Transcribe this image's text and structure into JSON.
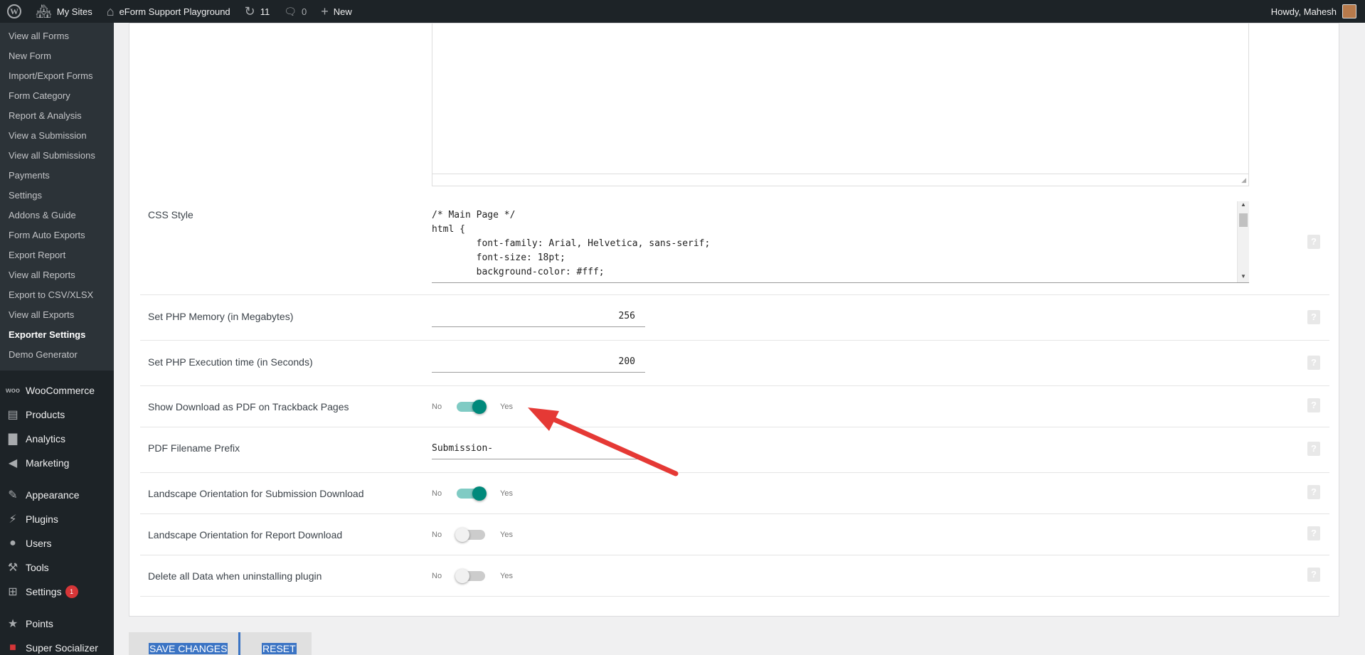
{
  "adminbar": {
    "my_sites": "My Sites",
    "site_name": "eForm Support Playground",
    "updates_count": "11",
    "comments_count": "0",
    "new_label": "New",
    "howdy": "Howdy, Mahesh"
  },
  "sidebar": {
    "submenu": [
      {
        "label": "View all Forms"
      },
      {
        "label": "New Form"
      },
      {
        "label": "Import/Export Forms"
      },
      {
        "label": "Form Category"
      },
      {
        "label": "Report & Analysis"
      },
      {
        "label": "View a Submission"
      },
      {
        "label": "View all Submissions"
      },
      {
        "label": "Payments"
      },
      {
        "label": "Settings"
      },
      {
        "label": "Addons & Guide"
      },
      {
        "label": "Form Auto Exports"
      },
      {
        "label": "Export Report"
      },
      {
        "label": "View all Reports"
      },
      {
        "label": "Export to CSV/XLSX"
      },
      {
        "label": "View all Exports"
      },
      {
        "label": "Exporter Settings"
      },
      {
        "label": "Demo Generator"
      }
    ],
    "menu": [
      {
        "label": "WooCommerce",
        "icon": "woo-icon"
      },
      {
        "label": "Products",
        "icon": "archive-icon"
      },
      {
        "label": "Analytics",
        "icon": "chart-bar-icon"
      },
      {
        "label": "Marketing",
        "icon": "megaphone-icon"
      },
      {
        "label": "Appearance",
        "icon": "paintbrush-icon"
      },
      {
        "label": "Plugins",
        "icon": "plug-icon"
      },
      {
        "label": "Users",
        "icon": "user-icon"
      },
      {
        "label": "Tools",
        "icon": "wrench-icon"
      },
      {
        "label": "Settings",
        "icon": "settings-icon",
        "badge": "1"
      },
      {
        "label": "Points",
        "icon": "star-icon"
      },
      {
        "label": "Super Socializer",
        "icon": "social-icon"
      }
    ]
  },
  "settings": {
    "css_style": {
      "label": "CSS Style",
      "code": "/* Main Page */\nhtml {\n        font-family: Arial, Helvetica, sans-serif;\n        font-size: 18pt;\n        background-color: #fff;"
    },
    "php_memory": {
      "label": "Set PHP Memory (in Megabytes)",
      "value": "256"
    },
    "php_exec": {
      "label": "Set PHP Execution time (in Seconds)",
      "value": "200"
    },
    "show_pdf": {
      "label": "Show Download as PDF on Trackback Pages",
      "no": "No",
      "yes": "Yes",
      "state": "on"
    },
    "pdf_prefix": {
      "label": "PDF Filename Prefix",
      "value": "Submission-"
    },
    "landscape_submission": {
      "label": "Landscape Orientation for Submission Download",
      "no": "No",
      "yes": "Yes",
      "state": "on"
    },
    "landscape_report": {
      "label": "Landscape Orientation for Report Download",
      "no": "No",
      "yes": "Yes",
      "state": "off"
    },
    "delete_data": {
      "label": "Delete all Data when uninstalling plugin",
      "no": "No",
      "yes": "Yes",
      "state": "off"
    }
  },
  "help_glyph": "?",
  "buttons": {
    "save": "SAVE CHANGES",
    "reset": "RESET"
  },
  "colors": {
    "accent": "#00897b",
    "arrow": "#e53935",
    "button_highlight": "#3b74c4"
  }
}
